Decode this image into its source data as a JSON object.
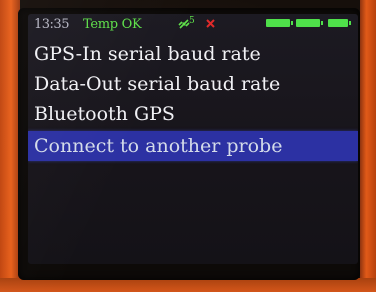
{
  "status_bar": {
    "time": "13:35",
    "temp_status": "Temp OK",
    "satellite_count": "5",
    "satellite_icon": "satellite-icon",
    "gps_off_icon": "cross-icon",
    "battery_icons": [
      "battery-icon",
      "battery-icon",
      "battery-icon"
    ],
    "accent_green": "#5fe04a",
    "alert_red": "#e02a2a"
  },
  "menu": {
    "items": [
      {
        "label": "GPS-In serial baud rate",
        "selected": false
      },
      {
        "label": "Data-Out serial baud rate",
        "selected": false
      },
      {
        "label": "Bluetooth GPS",
        "selected": false
      },
      {
        "label": "Connect to another probe",
        "selected": true
      }
    ],
    "selection_color": "#2c31a3"
  }
}
